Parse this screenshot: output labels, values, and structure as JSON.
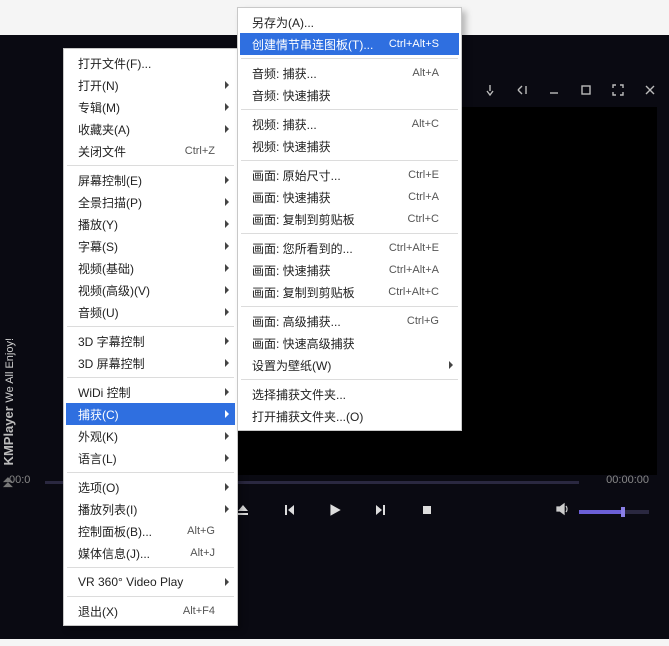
{
  "brand": {
    "name": "KMPlayer",
    "tagline": "We All Enjoy!"
  },
  "time": {
    "current": "00:0",
    "total": "00:00:00"
  },
  "menu1": {
    "groups": [
      [
        {
          "label": "打开文件(F)...",
          "shortcut": "",
          "sub": false
        },
        {
          "label": "打开(N)",
          "shortcut": "",
          "sub": true
        },
        {
          "label": "专辑(M)",
          "shortcut": "",
          "sub": true
        },
        {
          "label": "收藏夹(A)",
          "shortcut": "",
          "sub": true
        },
        {
          "label": "关闭文件",
          "shortcut": "Ctrl+Z",
          "sub": false
        }
      ],
      [
        {
          "label": "屏幕控制(E)",
          "shortcut": "",
          "sub": true
        },
        {
          "label": "全景扫描(P)",
          "shortcut": "",
          "sub": true
        },
        {
          "label": "播放(Y)",
          "shortcut": "",
          "sub": true
        },
        {
          "label": "字幕(S)",
          "shortcut": "",
          "sub": true
        },
        {
          "label": "视频(基础)",
          "shortcut": "",
          "sub": true
        },
        {
          "label": "视频(高级)(V)",
          "shortcut": "",
          "sub": true
        },
        {
          "label": "音频(U)",
          "shortcut": "",
          "sub": true
        }
      ],
      [
        {
          "label": "3D 字幕控制",
          "shortcut": "",
          "sub": true
        },
        {
          "label": "3D 屏幕控制",
          "shortcut": "",
          "sub": true
        }
      ],
      [
        {
          "label": "WiDi 控制",
          "shortcut": "",
          "sub": true
        },
        {
          "label": "捕获(C)",
          "shortcut": "",
          "sub": true,
          "hl": true
        },
        {
          "label": "外观(K)",
          "shortcut": "",
          "sub": true
        },
        {
          "label": "语言(L)",
          "shortcut": "",
          "sub": true
        }
      ],
      [
        {
          "label": "选项(O)",
          "shortcut": "",
          "sub": true
        },
        {
          "label": "播放列表(I)",
          "shortcut": "",
          "sub": true
        },
        {
          "label": "控制面板(B)...",
          "shortcut": "Alt+G",
          "sub": false
        },
        {
          "label": "媒体信息(J)...",
          "shortcut": "Alt+J",
          "sub": false
        }
      ],
      [
        {
          "label": "VR 360° Video Play",
          "shortcut": "",
          "sub": true
        }
      ],
      [
        {
          "label": "退出(X)",
          "shortcut": "Alt+F4",
          "sub": false
        }
      ]
    ]
  },
  "menu2": {
    "groups": [
      [
        {
          "label": "另存为(A)...",
          "shortcut": "",
          "sub": false
        },
        {
          "label": "创建情节串连图板(T)...",
          "shortcut": "Ctrl+Alt+S",
          "sub": false,
          "hl": true
        }
      ],
      [
        {
          "label": "音频: 捕获...",
          "shortcut": "Alt+A",
          "sub": false
        },
        {
          "label": "音频: 快速捕获",
          "shortcut": "",
          "sub": false
        }
      ],
      [
        {
          "label": "视频: 捕获...",
          "shortcut": "Alt+C",
          "sub": false
        },
        {
          "label": "视频: 快速捕获",
          "shortcut": "",
          "sub": false
        }
      ],
      [
        {
          "label": "画面: 原始尺寸...",
          "shortcut": "Ctrl+E",
          "sub": false
        },
        {
          "label": "画面: 快速捕获",
          "shortcut": "Ctrl+A",
          "sub": false
        },
        {
          "label": "画面: 复制到剪贴板",
          "shortcut": "Ctrl+C",
          "sub": false
        }
      ],
      [
        {
          "label": "画面: 您所看到的...",
          "shortcut": "Ctrl+Alt+E",
          "sub": false
        },
        {
          "label": "画面: 快速捕获",
          "shortcut": "Ctrl+Alt+A",
          "sub": false
        },
        {
          "label": "画面: 复制到剪贴板",
          "shortcut": "Ctrl+Alt+C",
          "sub": false
        }
      ],
      [
        {
          "label": "画面: 高级捕获...",
          "shortcut": "Ctrl+G",
          "sub": false
        },
        {
          "label": "画面: 快速高级捕获",
          "shortcut": "",
          "sub": false
        },
        {
          "label": "设置为壁纸(W)",
          "shortcut": "",
          "sub": true
        }
      ],
      [
        {
          "label": "选择捕获文件夹...",
          "shortcut": "",
          "sub": false
        },
        {
          "label": "打开捕获文件夹...(O)",
          "shortcut": "",
          "sub": false
        }
      ]
    ]
  }
}
